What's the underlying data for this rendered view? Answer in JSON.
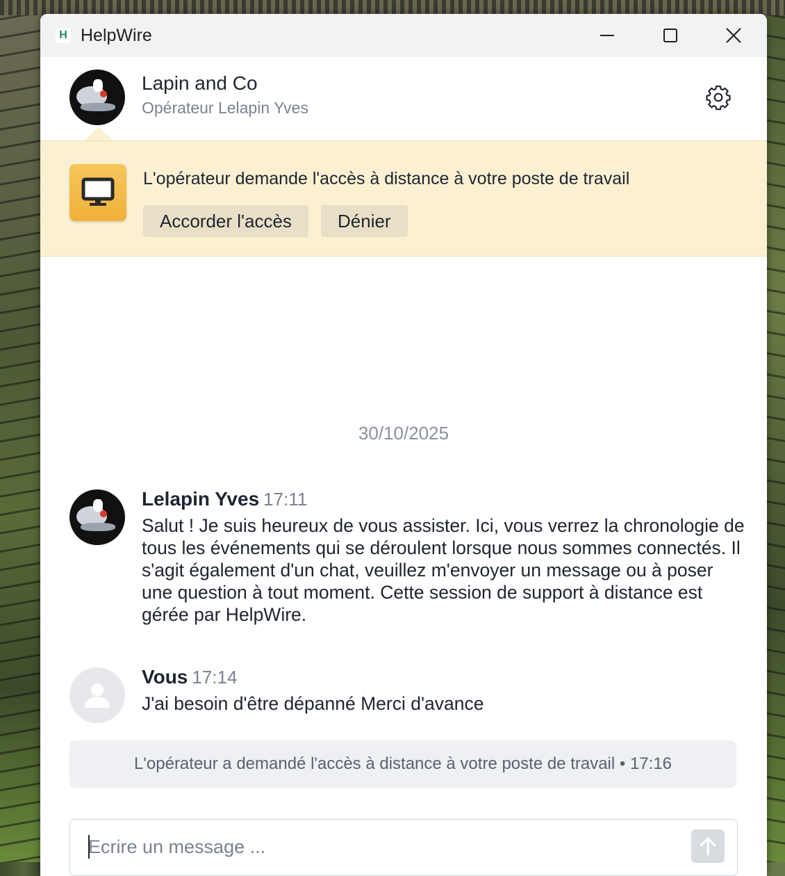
{
  "window": {
    "app_title": "HelpWire",
    "logo_letter": "H",
    "controls": {
      "minimize_icon": "minimize-icon",
      "maximize_icon": "maximize-icon",
      "close_icon": "close-icon"
    }
  },
  "header": {
    "company": "Lapin and Co",
    "operator": "Opérateur Lelapin Yves",
    "settings_icon": "gear-icon"
  },
  "access_request": {
    "text": "L'opérateur demande l'accès à distance à votre poste de travail",
    "icon": "monitor-icon",
    "accent_color": "#f2b843",
    "grant_label": "Accorder l'accès",
    "deny_label": "Dénier"
  },
  "chat": {
    "date": "30/10/2025",
    "messages": [
      {
        "author": "Lelapin Yves",
        "time": "17:11",
        "text": "Salut ! Je suis heureux de vous assister. Ici, vous verrez la chronologie de tous les événements qui se déroulent lorsque nous sommes connectés. Il s'agit également d'un chat, veuillez m'envoyer un message ou à poser une question à tout moment. Cette session de support à distance est gérée par HelpWire."
      },
      {
        "author": "Vous",
        "time": "17:14",
        "text": "J'ai besoin d'être dépanné Merci d'avance"
      }
    ],
    "event": "L'opérateur a demandé l'accès à distance à votre poste de travail • 17:16"
  },
  "composer": {
    "placeholder": "Ecrire un message ...",
    "send_icon": "arrow-up-icon"
  }
}
